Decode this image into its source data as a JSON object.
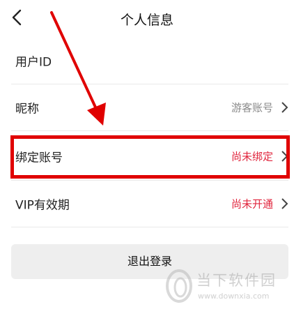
{
  "header": {
    "title": "个人信息"
  },
  "rows": [
    {
      "label": "用户ID",
      "value": ""
    },
    {
      "label": "昵称",
      "value": "游客账号"
    },
    {
      "label": "绑定账号",
      "value": "尚未绑定"
    },
    {
      "label": "VIP有效期",
      "value": "尚未开通"
    }
  ],
  "colors": {
    "value_gray": "#8a8a8a",
    "value_red": "#e0243c",
    "annotation": "#e00000"
  },
  "logout_label": "退出登录",
  "watermark": {
    "name": "当下软件园",
    "url": "www.downxia.com"
  }
}
